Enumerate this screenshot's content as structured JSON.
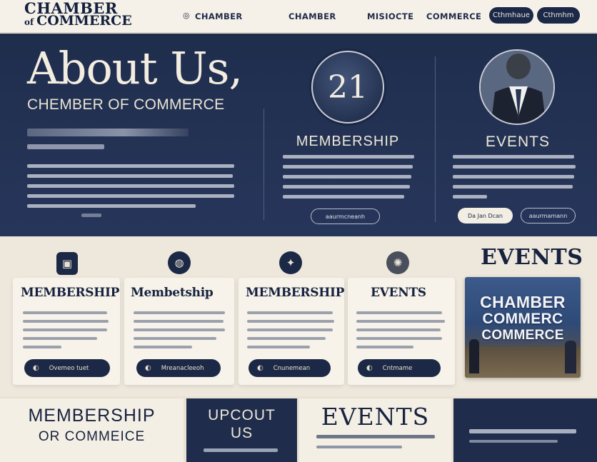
{
  "header": {
    "logo_line1": "CHAMBER",
    "logo_amp": "of",
    "logo_line2": "COMMERCE",
    "nav": [
      "CHAMBER",
      "CHAMBER",
      "MISIOCTE",
      "COMMERCE"
    ],
    "nav_prefix_icon": "globe-icon",
    "button_1": "Cthmhaue",
    "button_2": "Cthmhm"
  },
  "hero": {
    "title": "About Us,",
    "subtitle": "CHEMBER OF COMMERCE",
    "badge_number": "21",
    "membership_title": "MEMBERSHIP",
    "membership_button": "aaurmcneanh",
    "events_title": "EVENTS",
    "events_button_1": "Da Jan Dcan",
    "events_button_2": "aaurmamann"
  },
  "cards": [
    {
      "title": "MEMBERSHIP",
      "icon": "document-icon",
      "button": "Ovemeo tuet"
    },
    {
      "title": "Membetship",
      "icon": "globe-icon",
      "button": "Mreanacleeoh"
    },
    {
      "title": "MEMBERSHIP",
      "icon": "handshake-icon",
      "button": "Cnunemean"
    },
    {
      "title": "EVENTS",
      "icon": "seal-icon",
      "button": "Cntmame"
    }
  ],
  "events_heading": "EVENTS",
  "photo": {
    "line1": "CHAMBER",
    "line2": "COMMERC",
    "line3": "COMMERCE"
  },
  "bottom": {
    "panel1_line1": "MEMBERSHIP",
    "panel1_line2": "OR COMMEICE",
    "panel2_line1": "UPCOUT",
    "panel2_line2": "US",
    "panel3_title": "EVENTS"
  },
  "colors": {
    "navy": "#1c2946",
    "cream": "#ece6da",
    "hero_bg": "#243355"
  }
}
